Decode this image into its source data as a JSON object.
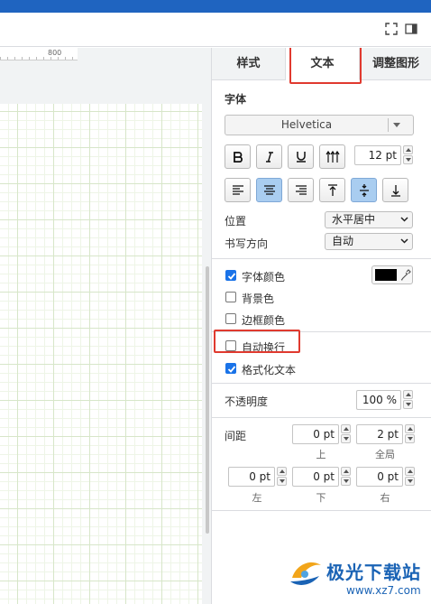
{
  "colors": {
    "titlebar": "#1f64c0",
    "accent": "#1a73e8",
    "highlight": "#e03a2f",
    "font_color": "#000000"
  },
  "ruler": {
    "label": "800"
  },
  "toolbar": {
    "icons": [
      "fullscreen-icon",
      "panel-toggle-icon"
    ]
  },
  "tabs": [
    {
      "label": "样式",
      "active": false
    },
    {
      "label": "文本",
      "active": true
    },
    {
      "label": "调整图形",
      "active": false
    }
  ],
  "font": {
    "section_label": "字体",
    "family": "Helvetica",
    "size": "12 pt"
  },
  "style_buttons": [
    "bold-icon",
    "italic-icon",
    "underline-icon",
    "vertical-text-icon"
  ],
  "align_buttons": [
    "align-left-icon",
    "align-center-icon",
    "align-right-icon",
    "align-top-icon",
    "align-middle-icon",
    "align-bottom-icon"
  ],
  "position": {
    "label": "位置",
    "value": "水平居中"
  },
  "writing_direction": {
    "label": "书写方向",
    "value": "自动"
  },
  "options": {
    "font_color": {
      "label": "字体颜色",
      "checked": true
    },
    "background_color": {
      "label": "背景色",
      "checked": false
    },
    "border_color": {
      "label": "边框颜色",
      "checked": false
    },
    "word_wrap": {
      "label": "自动换行",
      "checked": false
    },
    "formatted_text": {
      "label": "格式化文本",
      "checked": true
    }
  },
  "opacity": {
    "label": "不透明度",
    "value": "100 %"
  },
  "spacing": {
    "label": "间距",
    "top": {
      "value": "0 pt",
      "label": "上"
    },
    "global": {
      "value": "2 pt",
      "label": "全局"
    },
    "left": {
      "value": "0 pt",
      "label": "左"
    },
    "bottom": {
      "value": "0 pt",
      "label": "下"
    },
    "right": {
      "value": "0 pt",
      "label": "右"
    }
  },
  "watermark": {
    "brand": "极光下载站",
    "url": "www.xz7.com"
  }
}
